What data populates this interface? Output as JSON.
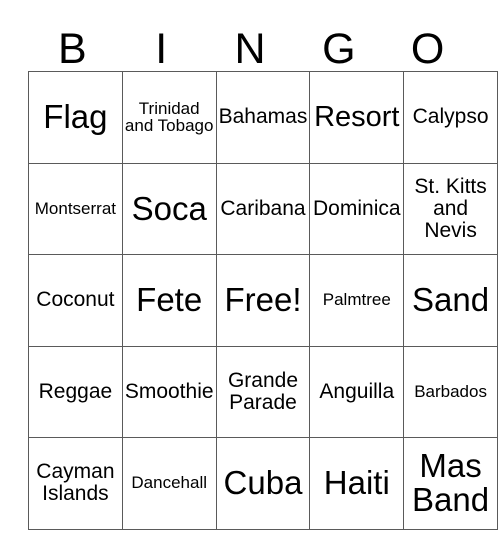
{
  "card": {
    "header_letters": [
      "B",
      "I",
      "N",
      "G",
      "O"
    ],
    "free_space_label": "Free!",
    "grid": [
      [
        {
          "text": "Flag",
          "size": "xl"
        },
        {
          "text": "Trinidad and Tobago",
          "size": "sm"
        },
        {
          "text": "Bahamas",
          "size": "md"
        },
        {
          "text": "Resort",
          "size": "lg"
        },
        {
          "text": "Calypso",
          "size": "md"
        }
      ],
      [
        {
          "text": "Montserrat",
          "size": "sm"
        },
        {
          "text": "Soca",
          "size": "xl"
        },
        {
          "text": "Caribana",
          "size": "md"
        },
        {
          "text": "Dominica",
          "size": "md"
        },
        {
          "text": "St. Kitts and Nevis",
          "size": "md"
        }
      ],
      [
        {
          "text": "Coconut",
          "size": "md"
        },
        {
          "text": "Fete",
          "size": "xl"
        },
        {
          "text": "Free!",
          "size": "xl"
        },
        {
          "text": "Palmtree",
          "size": "sm"
        },
        {
          "text": "Sand",
          "size": "xl"
        }
      ],
      [
        {
          "text": "Reggae",
          "size": "md"
        },
        {
          "text": "Smoothie",
          "size": "md"
        },
        {
          "text": "Grande Parade",
          "size": "md"
        },
        {
          "text": "Anguilla",
          "size": "md"
        },
        {
          "text": "Barbados",
          "size": "sm"
        }
      ],
      [
        {
          "text": "Cayman Islands",
          "size": "md"
        },
        {
          "text": "Dancehall",
          "size": "sm"
        },
        {
          "text": "Cuba",
          "size": "xl"
        },
        {
          "text": "Haiti",
          "size": "xl"
        },
        {
          "text": "Mas Band",
          "size": "xl"
        }
      ]
    ]
  },
  "colors": {
    "background": "#ffffff",
    "text": "#000000",
    "grid_line": "#5a5a5a"
  }
}
